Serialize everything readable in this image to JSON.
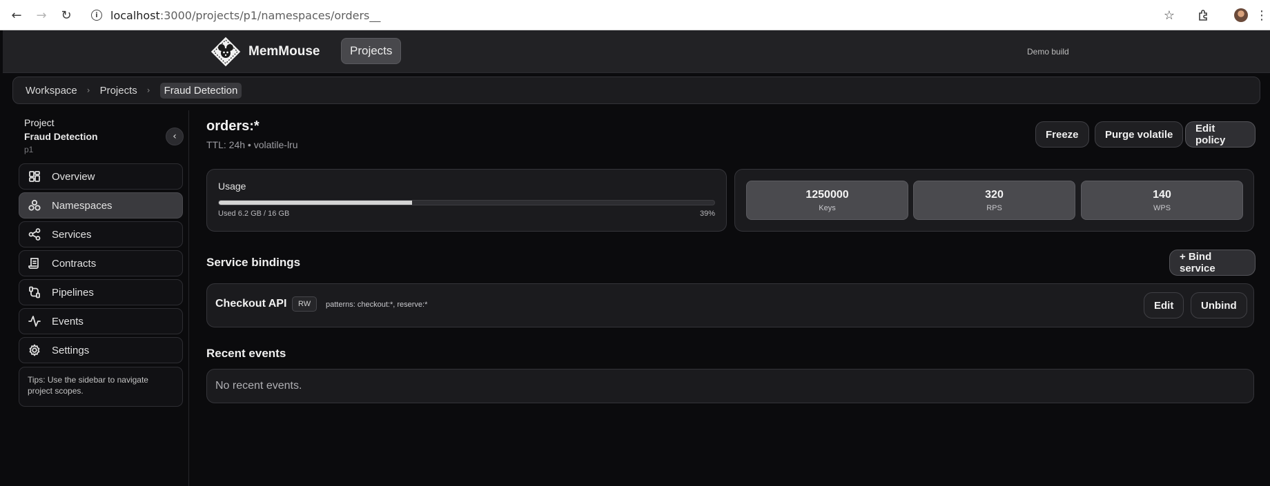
{
  "browser": {
    "url_host": "localhost",
    "url_path": ":3000/projects/p1/namespaces/orders__"
  },
  "header": {
    "brand": "MemMouse",
    "projects_label": "Projects",
    "build_label": "Demo build"
  },
  "breadcrumb": {
    "items": [
      "Workspace",
      "Projects",
      "Fraud Detection"
    ]
  },
  "sidebar": {
    "heading": "Project",
    "project_name": "Fraud Detection",
    "project_id": "p1",
    "items": [
      {
        "label": "Overview",
        "icon": "overview-icon"
      },
      {
        "label": "Namespaces",
        "icon": "namespaces-icon",
        "active": true
      },
      {
        "label": "Services",
        "icon": "services-icon"
      },
      {
        "label": "Contracts",
        "icon": "contracts-icon"
      },
      {
        "label": "Pipelines",
        "icon": "pipelines-icon"
      },
      {
        "label": "Events",
        "icon": "events-icon"
      },
      {
        "label": "Settings",
        "icon": "settings-icon"
      }
    ],
    "tips": "Tips: Use the sidebar to navigate project scopes."
  },
  "namespace": {
    "title": "orders:*",
    "subtitle": "TTL: 24h • volatile-lru",
    "actions": {
      "freeze": "Freeze",
      "purge": "Purge volatile",
      "edit_policy": "Edit policy"
    }
  },
  "usage": {
    "label": "Usage",
    "used_text": "Used 6.2 GB / 16 GB",
    "percent_text": "39%",
    "fraction": 0.39
  },
  "stats": [
    {
      "value": "1250000",
      "label": "Keys"
    },
    {
      "value": "320",
      "label": "RPS"
    },
    {
      "value": "140",
      "label": "WPS"
    }
  ],
  "bindings": {
    "title": "Service bindings",
    "bind_button": "+ Bind service",
    "items": [
      {
        "name": "Checkout API",
        "mode": "RW",
        "patterns": "patterns: checkout:*, reserve:*",
        "edit_label": "Edit",
        "unbind_label": "Unbind"
      }
    ]
  },
  "events": {
    "title": "Recent events",
    "empty": "No recent events."
  }
}
